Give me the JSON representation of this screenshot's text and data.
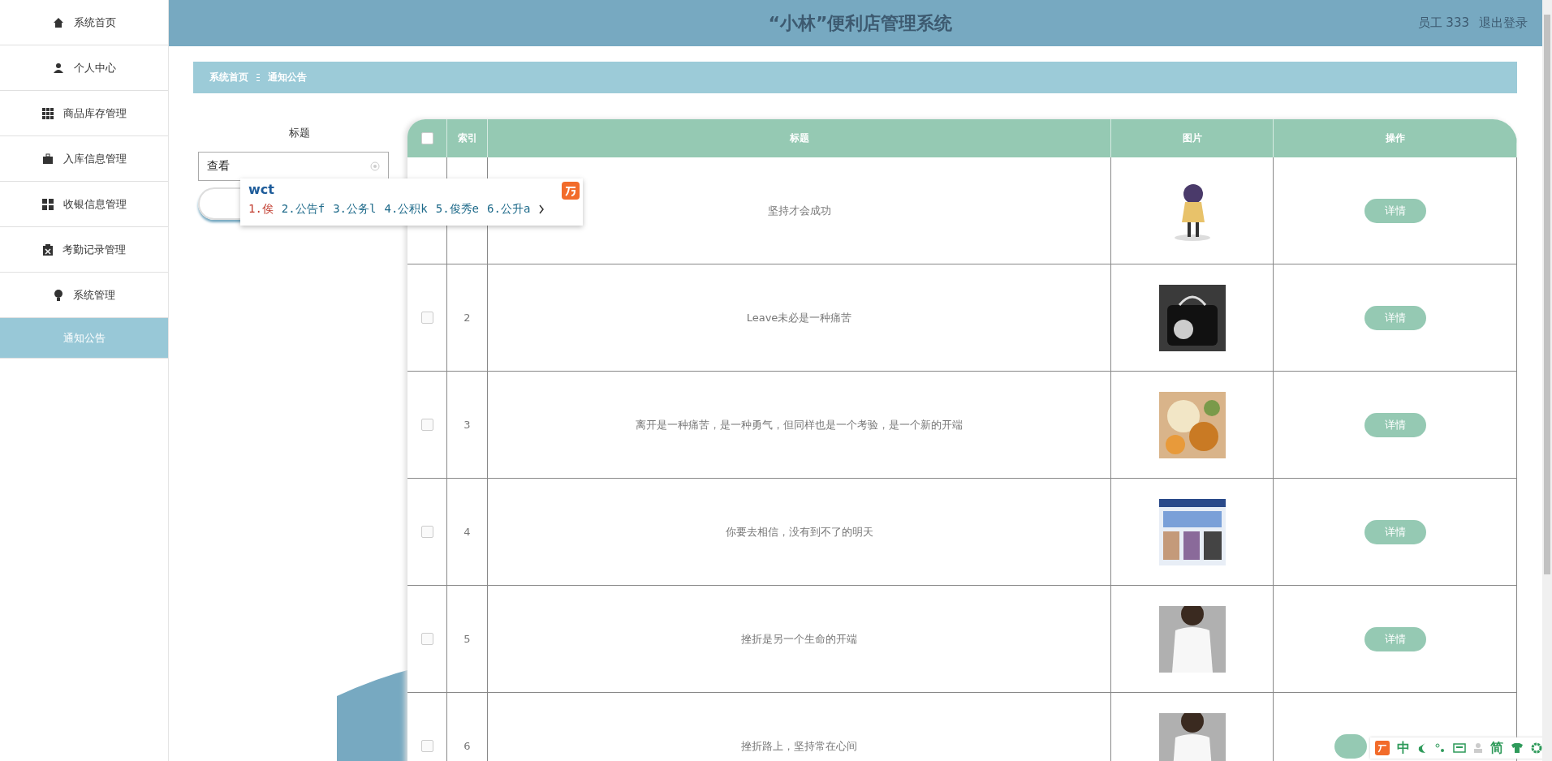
{
  "sidebar": {
    "items": [
      {
        "label": "系统首页",
        "selected": false
      },
      {
        "label": "个人中心",
        "selected": false
      },
      {
        "label": "商品库存管理",
        "selected": false
      },
      {
        "label": "入库信息管理",
        "selected": false
      },
      {
        "label": "收银信息管理",
        "selected": false
      },
      {
        "label": "考勤记录管理",
        "selected": false
      },
      {
        "label": "系统管理",
        "selected": false
      },
      {
        "label": "通知公告",
        "selected": true
      }
    ]
  },
  "header": {
    "title": "“小林”便利店管理系统",
    "user": "员工 333",
    "logout": "退出登录"
  },
  "breadcrumb": [
    "系统首页",
    "通知公告"
  ],
  "search": {
    "label": "标题",
    "value": "查看"
  },
  "table": {
    "select_all_checked": false,
    "columns": [
      "索引",
      "标题",
      "图片",
      "操作"
    ],
    "rows": [
      {
        "title": "坚持才会成功",
        "action": "详情"
      },
      {
        "checked": false,
        "index": "2",
        "title": "Leave未必是一种痛苦",
        "action": "详情"
      },
      {
        "checked": false,
        "index": "3",
        "title": "离开是一种痛苦，是一种勇气，但同样也是一个考验，是一个新的开端",
        "action": "详情"
      },
      {
        "checked": false,
        "index": "4",
        "title": "你要去相信，没有到不了的明天",
        "action": "详情"
      },
      {
        "checked": false,
        "index": "5",
        "title": "挫折是另一个生命的开端",
        "action": "详情"
      },
      {
        "checked": false,
        "index": "6",
        "title": "挫折路上，坚持常在心间"
      }
    ]
  },
  "ime": {
    "input": "wct",
    "candidates": [
      {
        "text": "1.俟",
        "selected": true
      },
      {
        "text": "2.公告f",
        "selected": false
      },
      {
        "text": "3.公务l",
        "selected": false
      },
      {
        "text": "4.公积k",
        "selected": false
      },
      {
        "text": "5.俊秀e",
        "selected": false
      },
      {
        "text": "6.公升a",
        "selected": false
      }
    ],
    "toolbar": [
      "中",
      "简"
    ]
  }
}
